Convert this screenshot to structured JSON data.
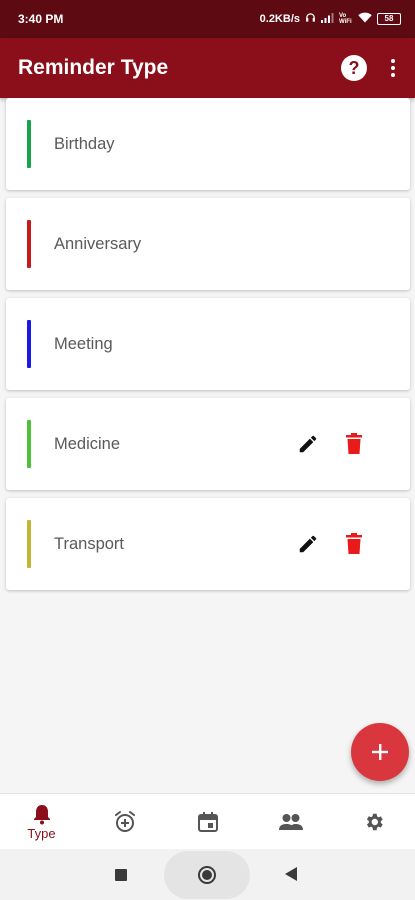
{
  "status_bar": {
    "time": "3:40 PM",
    "net_speed": "0.2KB/s",
    "icons": [
      "headset-icon",
      "signal-icon",
      "volte-icon",
      "wifi-icon"
    ],
    "volte_label": "Vo WiFi",
    "battery": "58"
  },
  "app_bar": {
    "title": "Reminder Type",
    "help_icon": "help-circle-icon",
    "help_glyph": "?",
    "more_icon": "more-vertical-icon"
  },
  "reminder_types": [
    {
      "label": "Birthday",
      "color": "#1aa34a",
      "editable": false
    },
    {
      "label": "Anniversary",
      "color": "#c41a1a",
      "editable": false
    },
    {
      "label": "Meeting",
      "color": "#1a1ae8",
      "editable": false
    },
    {
      "label": "Medicine",
      "color": "#4fc23a",
      "editable": true
    },
    {
      "label": "Transport",
      "color": "#c4b534",
      "editable": true
    }
  ],
  "actions": {
    "edit_icon": "pencil-icon",
    "delete_icon": "trash-icon",
    "delete_color": "#e81a1a"
  },
  "fab": {
    "icon": "plus-icon",
    "color": "#d9373d"
  },
  "bottom_nav": {
    "items": [
      {
        "name": "type",
        "icon": "bell-icon",
        "label": "Type",
        "active": true
      },
      {
        "name": "alarm",
        "icon": "alarm-add-icon",
        "label": "",
        "active": false
      },
      {
        "name": "calendar",
        "icon": "calendar-icon",
        "label": "",
        "active": false
      },
      {
        "name": "contacts",
        "icon": "people-icon",
        "label": "",
        "active": false
      },
      {
        "name": "settings",
        "icon": "gear-icon",
        "label": "",
        "active": false
      }
    ]
  },
  "colors": {
    "primary": "#8a0f1b",
    "status_bar": "#5e0a13",
    "inactive_icon": "#555555"
  }
}
